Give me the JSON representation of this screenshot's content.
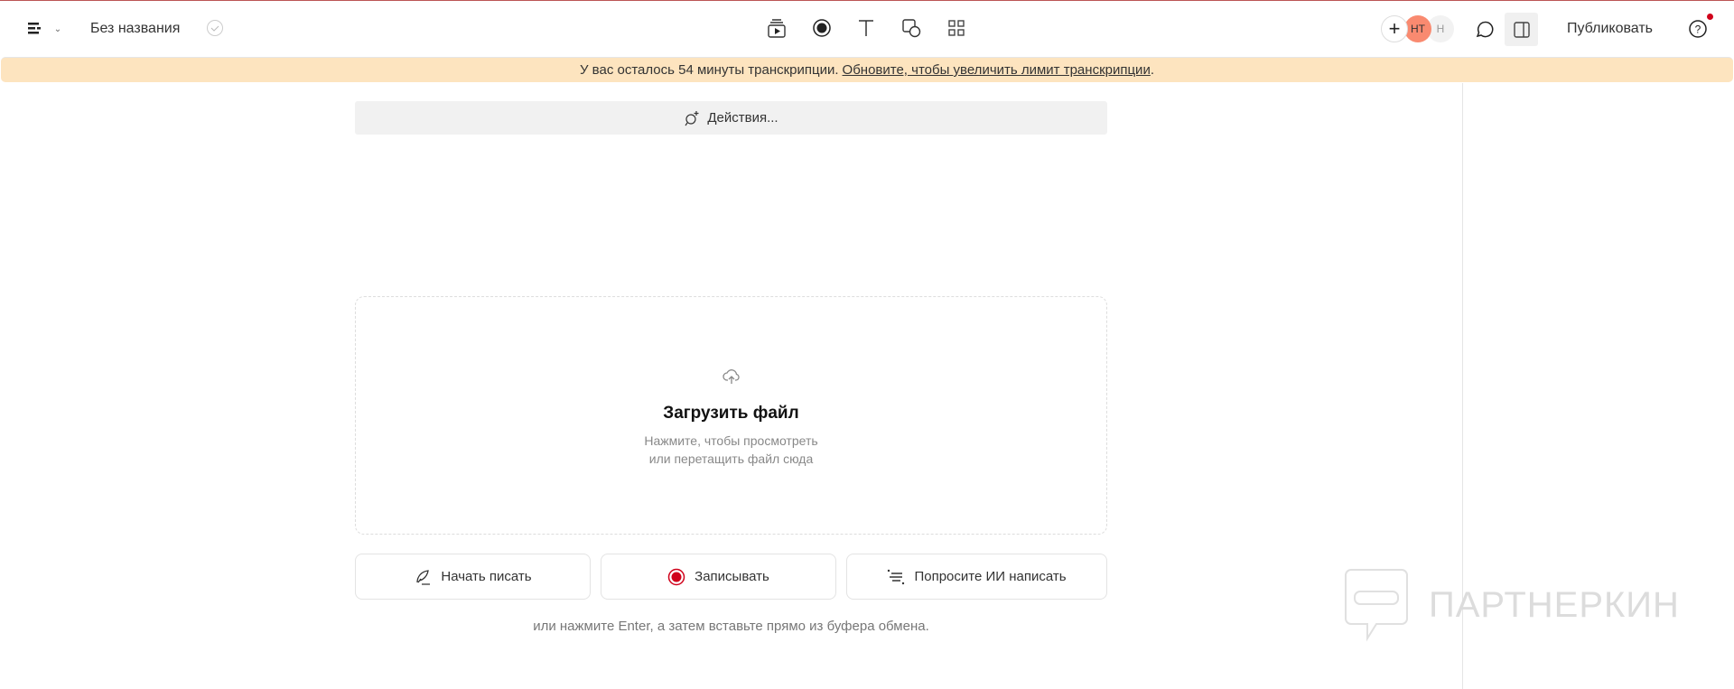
{
  "header": {
    "doc_title": "Без названия",
    "avatars": [
      "НТ",
      "Н"
    ],
    "publish_label": "Публиковать"
  },
  "banner": {
    "text": "У вас осталось 54 минуты транскрипции.",
    "link": "Обновите, чтобы увеличить лимит транскрипции",
    "suffix": "."
  },
  "actions": {
    "label": "Действия..."
  },
  "upload": {
    "title": "Загрузить файл",
    "line1": "Нажмите, чтобы просмотреть",
    "line2": "или перетащить файл сюда"
  },
  "buttons": {
    "write": "Начать писать",
    "record": "Записывать",
    "ai": "Попросите ИИ написать"
  },
  "hint": "или нажмите Enter, а затем вставьте прямо из буфера обмена.",
  "watermark": "ПАРТНЕРКИН",
  "colors": {
    "banner": "#fde4bf",
    "record": "#d0021b",
    "avatar": "#f98a70"
  }
}
